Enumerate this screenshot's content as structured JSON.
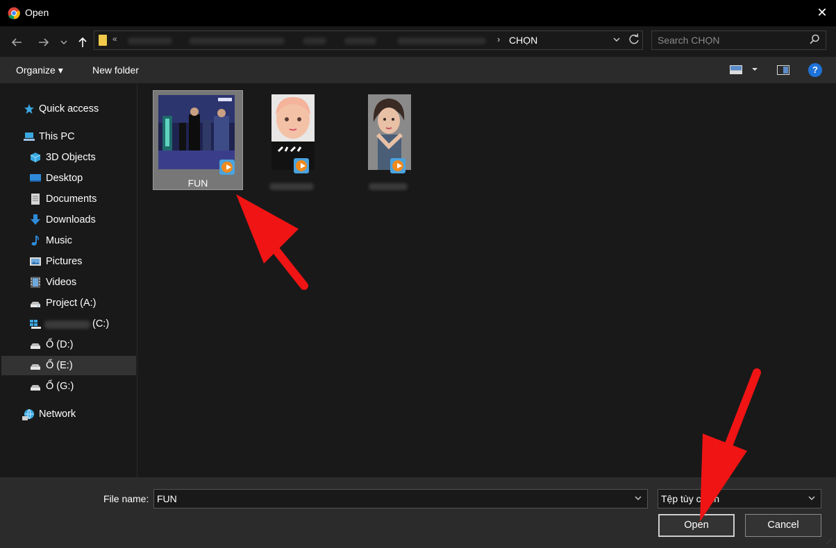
{
  "window": {
    "title": "Open",
    "close_glyph": "✕"
  },
  "nav": {
    "back_icon": "back-arrow-icon",
    "forward_icon": "forward-arrow-icon",
    "recent_icon": "chevron-down-icon",
    "up_icon": "up-arrow-icon"
  },
  "address": {
    "overflow": "«",
    "current": "CHỌN",
    "separator": "›"
  },
  "search": {
    "placeholder": "Search CHỌN"
  },
  "commands": {
    "organize": "Organize ▾",
    "new_folder": "New folder",
    "help": "?"
  },
  "sidebar": {
    "quick_access": "Quick access",
    "this_pc": "This PC",
    "items": [
      {
        "label": "3D Objects",
        "icon": "cube-icon",
        "color": "#3aa7e0"
      },
      {
        "label": "Desktop",
        "icon": "desktop-icon",
        "color": "#2f8bd8"
      },
      {
        "label": "Documents",
        "icon": "documents-icon",
        "color": "#d6d6d6"
      },
      {
        "label": "Downloads",
        "icon": "download-icon",
        "color": "#2f8bd8"
      },
      {
        "label": "Music",
        "icon": "music-icon",
        "color": "#2f8bd8"
      },
      {
        "label": "Pictures",
        "icon": "pictures-icon",
        "color": "#9fc3e6"
      },
      {
        "label": "Videos",
        "icon": "videos-icon",
        "color": "#7d7d7d"
      },
      {
        "label": "Project (A:)",
        "icon": "drive-icon",
        "color": "#d6d6d6"
      },
      {
        "label": "(C:)",
        "icon": "windows-drive-icon",
        "color": "#3aa7e0"
      },
      {
        "label": "Ổ (D:)",
        "icon": "drive-icon",
        "color": "#d6d6d6"
      },
      {
        "label": "Ổ (E:)",
        "icon": "drive-icon",
        "color": "#d6d6d6"
      },
      {
        "label": "Ổ (G:)",
        "icon": "drive-icon",
        "color": "#d6d6d6"
      }
    ],
    "network": "Network"
  },
  "files": [
    {
      "name": "FUN",
      "selected": true
    },
    {
      "name": "",
      "selected": false
    },
    {
      "name": "",
      "selected": false
    }
  ],
  "bottom": {
    "file_name_label": "File name:",
    "file_name_value": "FUN",
    "file_type": "Tệp tùy chỉnh",
    "open_button": "Open",
    "cancel_button": "Cancel"
  }
}
